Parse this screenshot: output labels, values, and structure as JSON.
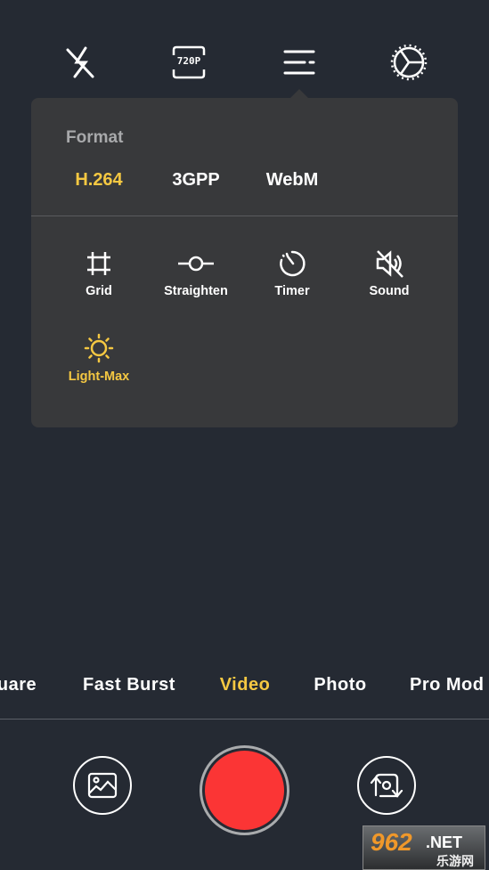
{
  "toolbar": {
    "flash_icon": "flash-off-icon",
    "resolution_label": "720P",
    "menu_icon": "menu-icon",
    "settings_icon": "settings-gear-icon"
  },
  "panel": {
    "format_label": "Format",
    "formats": [
      {
        "label": "H.264",
        "selected": true
      },
      {
        "label": "3GPP",
        "selected": false
      },
      {
        "label": "WebM",
        "selected": false
      }
    ],
    "tools": [
      {
        "label": "Grid",
        "icon": "grid-crop-icon"
      },
      {
        "label": "Straighten",
        "icon": "straighten-icon"
      },
      {
        "label": "Timer",
        "icon": "timer-icon"
      },
      {
        "label": "Sound",
        "icon": "sound-off-icon"
      },
      {
        "label": "Light-Max",
        "icon": "sun-icon",
        "active": true
      }
    ]
  },
  "modes": [
    {
      "label": "uare"
    },
    {
      "label": "Fast Burst"
    },
    {
      "label": "Video",
      "selected": true
    },
    {
      "label": "Photo"
    },
    {
      "label": "Pro Mod"
    }
  ],
  "colors": {
    "accent": "#f5c842",
    "shutter": "#fb3535",
    "background": "#252a33",
    "panel": "#38393b"
  },
  "watermark": {
    "text": "962.NET",
    "sub": "乐游网"
  }
}
